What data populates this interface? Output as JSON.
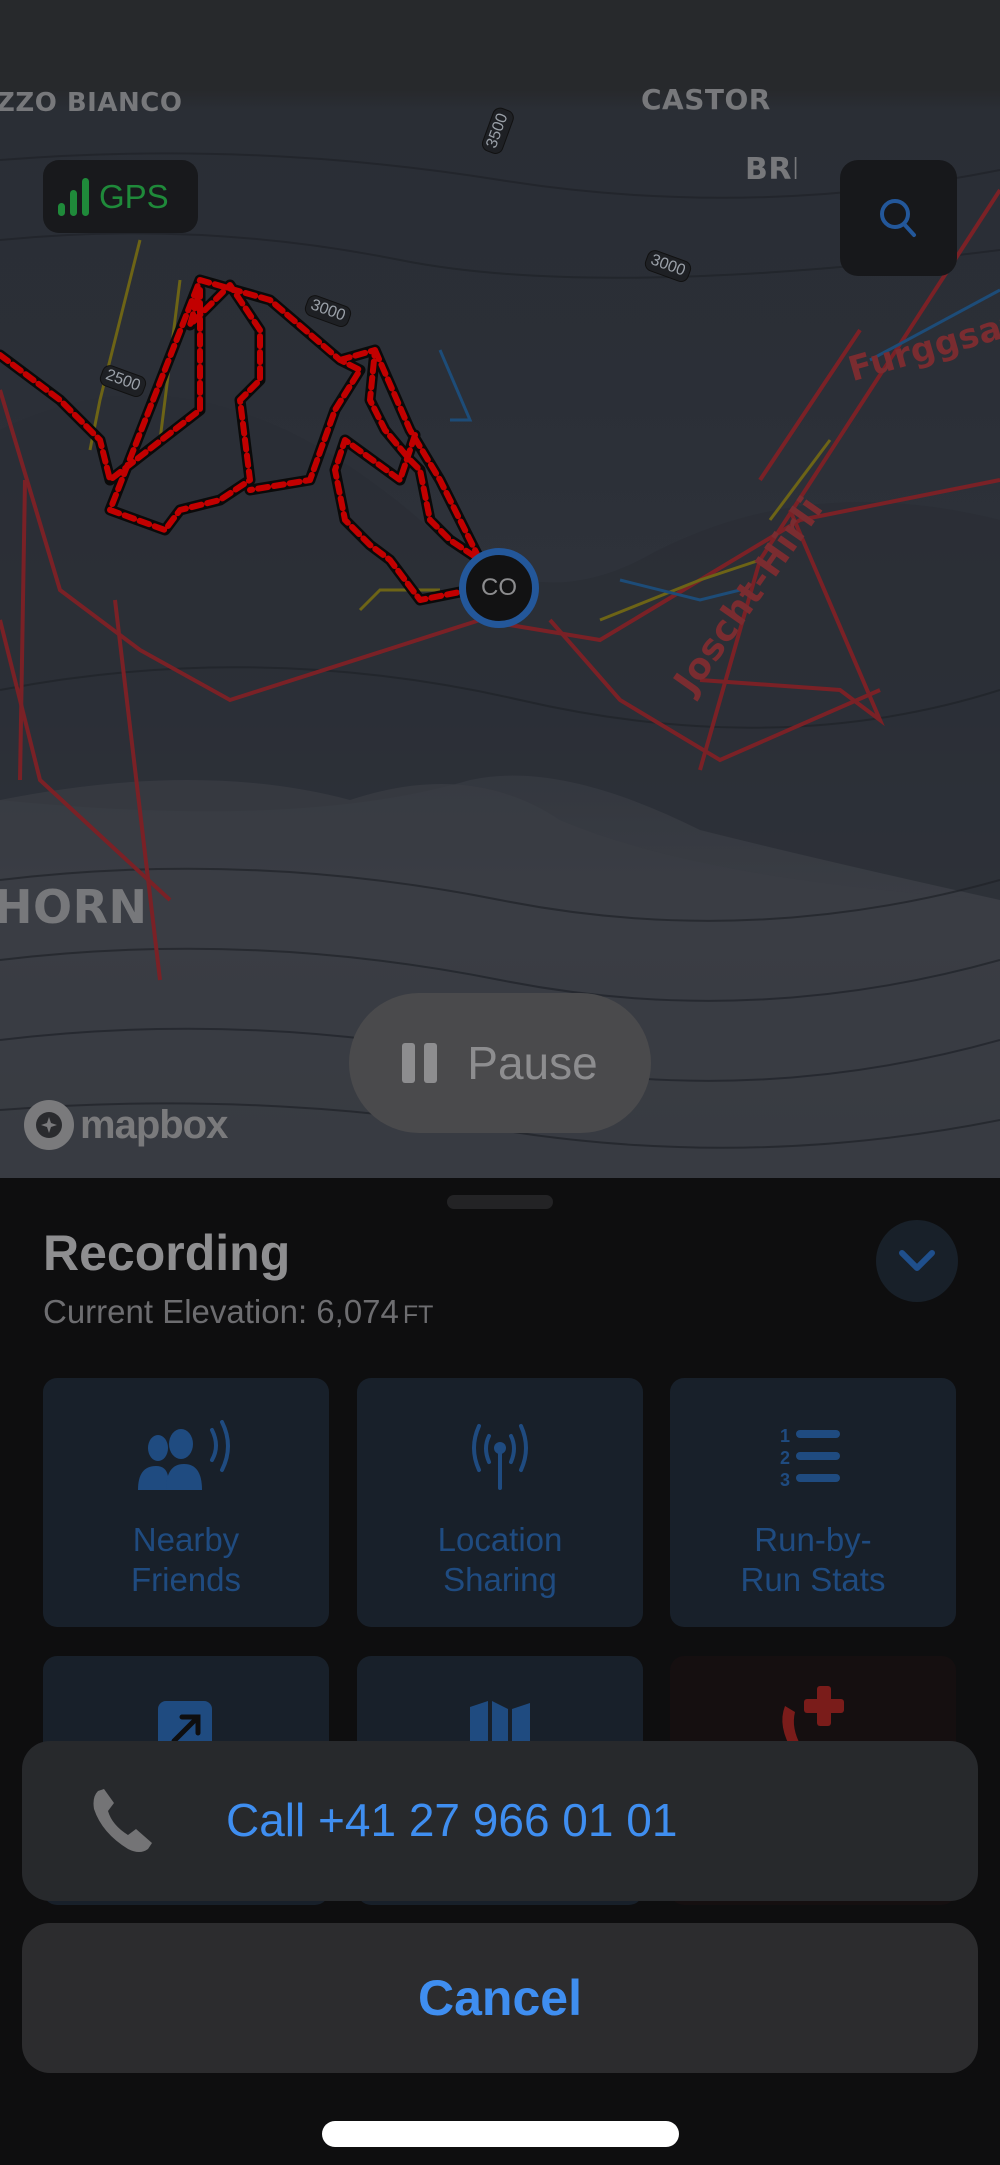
{
  "map": {
    "labels": {
      "pizzo_bianco": "ZZO BIANCO",
      "castor": "CASTOR",
      "breithorn": "BREITHORN",
      "horn": "HORN",
      "furggsattel": "Furggsat",
      "joscht_hirli": "Joscht-Hirli"
    },
    "contour_tags": [
      "3500",
      "3000",
      "3000",
      "2500"
    ],
    "gps_badge": {
      "label": "GPS",
      "signal_bars": 3,
      "color": "#1f8a3a"
    },
    "search_icon": "search-icon",
    "user_marker": {
      "initials": "CO",
      "ring_color": "#23579a"
    },
    "pause_button": {
      "label": "Pause",
      "icon": "pause-icon"
    },
    "attribution": "mapbox",
    "track_color": "#e00000"
  },
  "sheet": {
    "title": "Recording",
    "elevation_label": "Current Elevation: 6,074",
    "elevation_unit": "FT",
    "collapse_icon": "chevron-down-icon",
    "cards": [
      {
        "label": "Nearby\nFriends",
        "icon": "nearby-friends-icon"
      },
      {
        "label": "Location\nSharing",
        "icon": "antenna-icon"
      },
      {
        "label": "Run-by-\nRun Stats",
        "icon": "numbered-list-icon"
      },
      {
        "label": "",
        "icon": "share-arrow-icon"
      },
      {
        "label": "",
        "icon": "map-icon"
      },
      {
        "label": "",
        "icon": "emergency-call-icon"
      }
    ],
    "accent_color": "#1f4b80"
  },
  "action_sheet": {
    "call_label": "Call +41 27 966 01 01",
    "call_icon": "phone-icon",
    "cancel_label": "Cancel",
    "accent_color": "#3f8ef0"
  }
}
